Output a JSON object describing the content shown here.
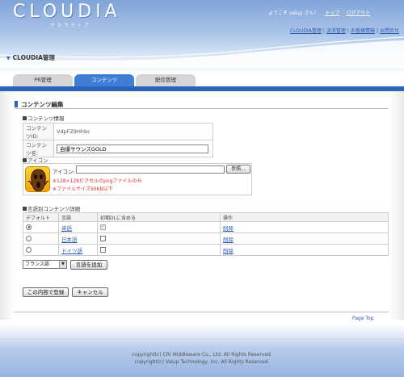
{
  "header": {
    "logo": "CLOUDIA",
    "logo_sub": "クラウディア",
    "welcome_text": "ようこそ valup さん！",
    "top_link": "トップ",
    "logout_link": "ログアウト",
    "links": [
      "CLOUDIA管理",
      "決済管理",
      "お客様情報",
      "お問合せ"
    ],
    "section_title": "CLOUDIA管理"
  },
  "tabs": [
    {
      "label": "PR管理",
      "active": false
    },
    {
      "label": "コンテンツ",
      "active": true
    },
    {
      "label": "配信管理",
      "active": false
    }
  ],
  "edit": {
    "title": "コンテンツ編集",
    "info_heading": "コンテンツ情報",
    "id_label": "コンテンツID:",
    "id_value": "VdpFZ9Hhbc",
    "name_label": "コンテンツ名:",
    "name_value": "自爆サウンズGOLD",
    "icon_heading": "アイコン",
    "icon_label": "アイコン:",
    "browse_button": "参照...",
    "note1": "※128×128ピクセルのpngファイルのみ",
    "note2": "※ファイルサイズ50KB以下",
    "lang_heading": "言語別コンテンツ詳細",
    "lang_columns": [
      "デフォルト",
      "言語",
      "初期DLに含める",
      "操作"
    ],
    "lang_rows": [
      {
        "language": "英語",
        "default": true,
        "include_initial": true,
        "include_disabled": true,
        "action": "削除"
      },
      {
        "language": "日本語",
        "default": false,
        "include_initial": false,
        "include_disabled": false,
        "action": "削除"
      },
      {
        "language": "ドイツ語",
        "default": false,
        "include_initial": false,
        "include_disabled": false,
        "action": "削除"
      }
    ],
    "language_select": "フランス語",
    "add_language_button": "言語を追加",
    "save_button": "この内容で登録",
    "cancel_button": "キャンセル"
  },
  "page_top": "Page Top",
  "footer": {
    "copyright1": "copyright(c) CRI Middleware Co., Ltd. All Rights Reserved.",
    "copyright2": "copyright(c) Valup Technology, Inc. All Rights Reserved."
  },
  "colors": {
    "accent": "#2b63b8",
    "tab_active": "#3f7ed6",
    "warning": "#e0322c"
  }
}
